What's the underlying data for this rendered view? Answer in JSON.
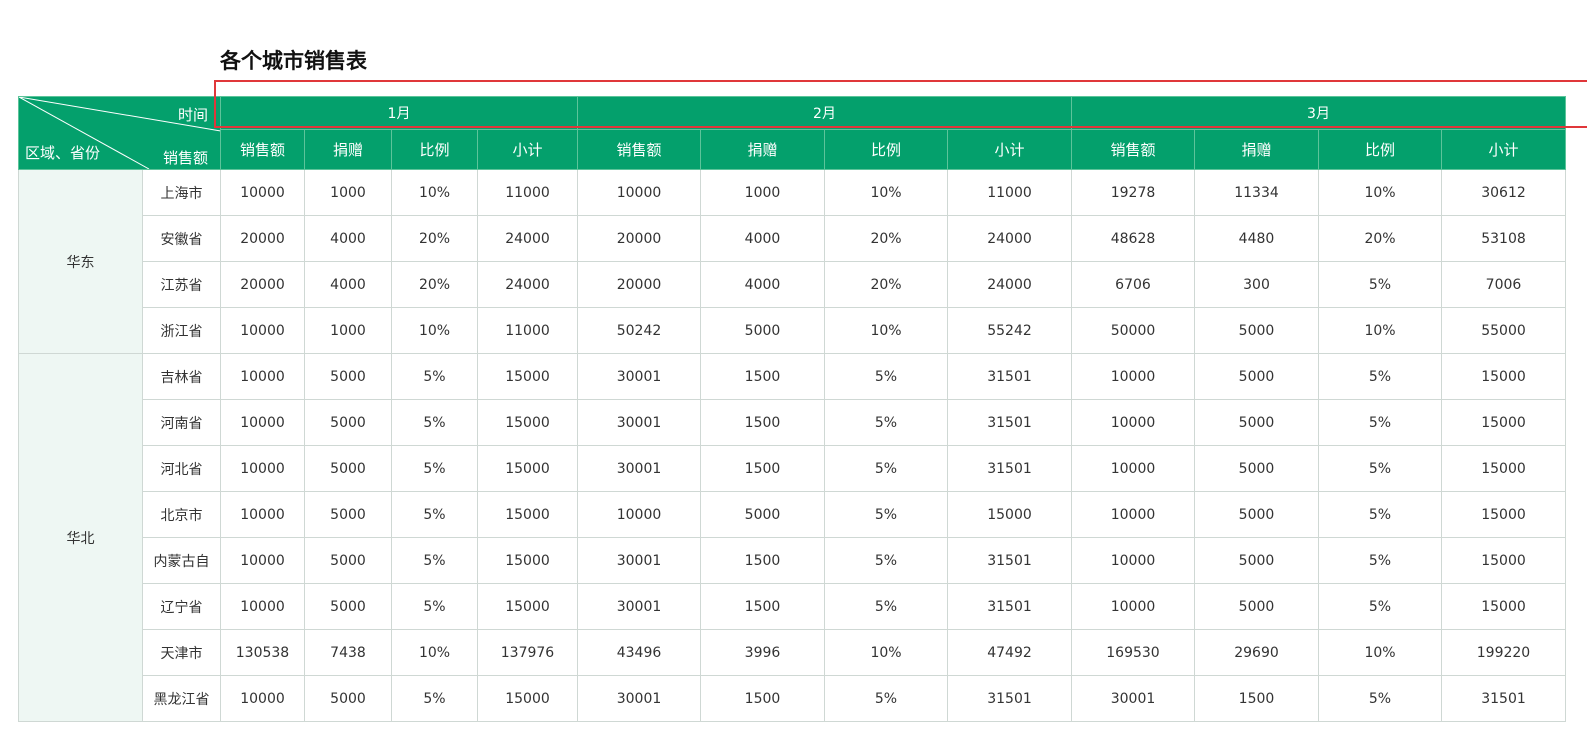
{
  "title": "各个城市销售表",
  "corner": {
    "time_label": "时间",
    "sales_label": "销售额",
    "region_label": "区域、省份"
  },
  "months": [
    "1月",
    "2月",
    "3月"
  ],
  "sub_headers": [
    "销售额",
    "捐赠",
    "比例",
    "小计"
  ],
  "colors": {
    "header_green": "#04a06c",
    "region_bg": "#eef7f3",
    "highlight_red": "#e0373a"
  },
  "regions": [
    {
      "name": "华东",
      "rows": [
        {
          "province": "上海市",
          "values": [
            "10000",
            "1000",
            "10%",
            "11000",
            "10000",
            "1000",
            "10%",
            "11000",
            "19278",
            "11334",
            "10%",
            "30612"
          ]
        },
        {
          "province": "安徽省",
          "values": [
            "20000",
            "4000",
            "20%",
            "24000",
            "20000",
            "4000",
            "20%",
            "24000",
            "48628",
            "4480",
            "20%",
            "53108"
          ]
        },
        {
          "province": "江苏省",
          "values": [
            "20000",
            "4000",
            "20%",
            "24000",
            "20000",
            "4000",
            "20%",
            "24000",
            "6706",
            "300",
            "5%",
            "7006"
          ]
        },
        {
          "province": "浙江省",
          "values": [
            "10000",
            "1000",
            "10%",
            "11000",
            "50242",
            "5000",
            "10%",
            "55242",
            "50000",
            "5000",
            "10%",
            "55000"
          ]
        }
      ]
    },
    {
      "name": "华北",
      "rows": [
        {
          "province": "吉林省",
          "values": [
            "10000",
            "5000",
            "5%",
            "15000",
            "30001",
            "1500",
            "5%",
            "31501",
            "10000",
            "5000",
            "5%",
            "15000"
          ]
        },
        {
          "province": "河南省",
          "values": [
            "10000",
            "5000",
            "5%",
            "15000",
            "30001",
            "1500",
            "5%",
            "31501",
            "10000",
            "5000",
            "5%",
            "15000"
          ]
        },
        {
          "province": "河北省",
          "values": [
            "10000",
            "5000",
            "5%",
            "15000",
            "30001",
            "1500",
            "5%",
            "31501",
            "10000",
            "5000",
            "5%",
            "15000"
          ]
        },
        {
          "province": "北京市",
          "values": [
            "10000",
            "5000",
            "5%",
            "15000",
            "10000",
            "5000",
            "5%",
            "15000",
            "10000",
            "5000",
            "5%",
            "15000"
          ]
        },
        {
          "province": "内蒙古自",
          "values": [
            "10000",
            "5000",
            "5%",
            "15000",
            "30001",
            "1500",
            "5%",
            "31501",
            "10000",
            "5000",
            "5%",
            "15000"
          ]
        },
        {
          "province": "辽宁省",
          "values": [
            "10000",
            "5000",
            "5%",
            "15000",
            "30001",
            "1500",
            "5%",
            "31501",
            "10000",
            "5000",
            "5%",
            "15000"
          ]
        },
        {
          "province": "天津市",
          "values": [
            "130538",
            "7438",
            "10%",
            "137976",
            "43496",
            "3996",
            "10%",
            "47492",
            "169530",
            "29690",
            "10%",
            "199220"
          ]
        },
        {
          "province": "黑龙江省",
          "values": [
            "10000",
            "5000",
            "5%",
            "15000",
            "30001",
            "1500",
            "5%",
            "31501",
            "30001",
            "1500",
            "5%",
            "31501"
          ]
        }
      ]
    }
  ]
}
